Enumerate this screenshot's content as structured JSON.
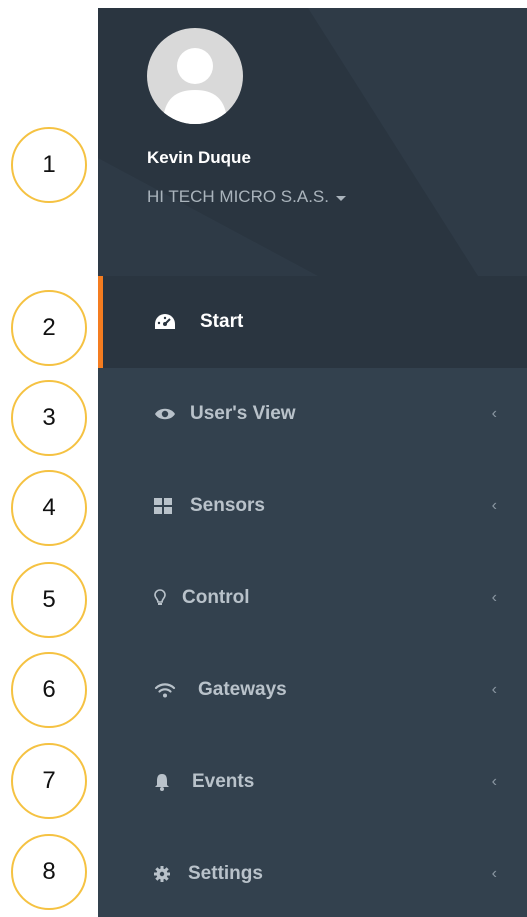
{
  "profile": {
    "name": "Kevin Duque",
    "company": "HI TECH MICRO S.A.S."
  },
  "menu": [
    {
      "label": "Start",
      "icon": "dashboard-icon",
      "active": true
    },
    {
      "label": "User's View",
      "icon": "eye-icon",
      "chevron": "‹"
    },
    {
      "label": "Sensors",
      "icon": "grid-icon",
      "chevron": "‹"
    },
    {
      "label": "Control",
      "icon": "lightbulb-icon",
      "chevron": "‹"
    },
    {
      "label": "Gateways",
      "icon": "wifi-icon",
      "chevron": "‹"
    },
    {
      "label": "Events",
      "icon": "bell-icon",
      "chevron": "‹"
    },
    {
      "label": "Settings",
      "icon": "gear-icon",
      "chevron": "‹"
    }
  ],
  "annotations": [
    "1",
    "2",
    "3",
    "4",
    "5",
    "6",
    "7",
    "8"
  ],
  "colors": {
    "sidebar_bg": "#33414e",
    "header_bg": "#2a3540",
    "active_accent": "#f47c20",
    "badge_border": "#f5c242"
  }
}
